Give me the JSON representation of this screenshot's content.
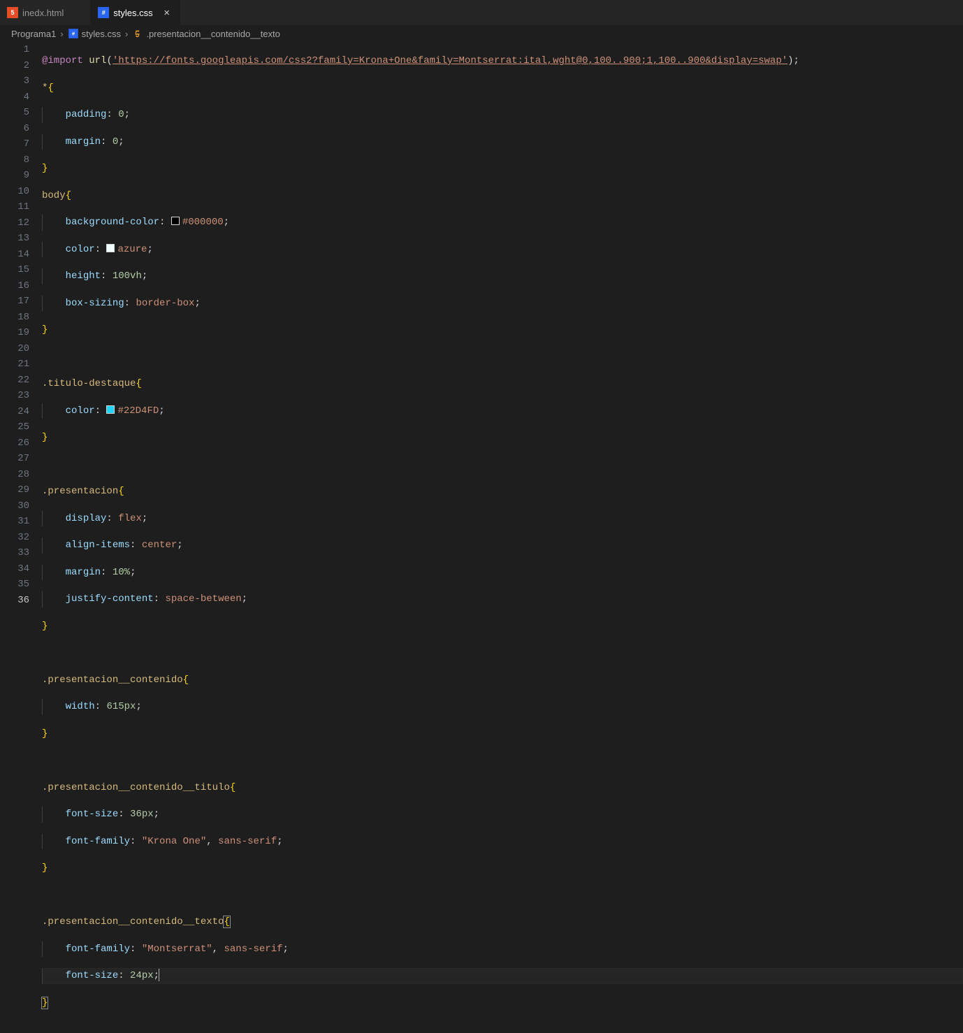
{
  "tabs": [
    {
      "label": "inedx.html",
      "icon": "html"
    },
    {
      "label": "styles.css",
      "icon": "css"
    }
  ],
  "breadcrumbs": {
    "root": "Programa1",
    "file": "styles.css",
    "symbol": ".presentacion__contenido__texto"
  },
  "code": {
    "l1": {
      "a": "@import",
      "b": "url",
      "c": "(",
      "d": "'https://fonts.googleapis.com/css2?family=Krona+One&family=Montserrat:ital,wght@0,100..900;1,100..900&display=swap'",
      "e": ")",
      "f": ";"
    },
    "l2": {
      "a": "*",
      "b": "{"
    },
    "l3": {
      "a": "padding",
      "b": ":",
      "c": "0",
      "d": ";"
    },
    "l4": {
      "a": "margin",
      "b": ":",
      "c": "0",
      "d": ";"
    },
    "l5": {
      "a": "}"
    },
    "l6": {
      "a": "body",
      "b": "{"
    },
    "l7": {
      "a": "background-color",
      "b": ":",
      "c": "#000000",
      "d": ";"
    },
    "l8": {
      "a": "color",
      "b": ":",
      "c": "azure",
      "d": ";"
    },
    "l9": {
      "a": "height",
      "b": ":",
      "c": "100vh",
      "d": ";"
    },
    "l10": {
      "a": "box-sizing",
      "b": ":",
      "c": "border-box",
      "d": ";"
    },
    "l11": {
      "a": "}"
    },
    "l13": {
      "a": ".titulo-destaque",
      "b": "{"
    },
    "l14": {
      "a": "color",
      "b": ":",
      "c": "#22D4FD",
      "d": ";"
    },
    "l15": {
      "a": "}"
    },
    "l17": {
      "a": ".presentacion",
      "b": "{"
    },
    "l18": {
      "a": "display",
      "b": ":",
      "c": "flex",
      "d": ";"
    },
    "l19": {
      "a": "align-items",
      "b": ":",
      "c": "center",
      "d": ";"
    },
    "l20": {
      "a": "margin",
      "b": ":",
      "c": "10%",
      "d": ";"
    },
    "l21": {
      "a": "justify-content",
      "b": ":",
      "c": "space-between",
      "d": ";"
    },
    "l22": {
      "a": "}"
    },
    "l24": {
      "a": ".presentacion__contenido",
      "b": "{"
    },
    "l25": {
      "a": "width",
      "b": ":",
      "c": "615px",
      "d": ";"
    },
    "l26": {
      "a": "}"
    },
    "l28": {
      "a": ".presentacion__contenido__titulo",
      "b": "{"
    },
    "l29": {
      "a": "font-size",
      "b": ":",
      "c": "36px",
      "d": ";"
    },
    "l30": {
      "a": "font-family",
      "b": ":",
      "c": "\"Krona One\"",
      "d": ",",
      "e": "sans-serif",
      "f": ";"
    },
    "l31": {
      "a": "}"
    },
    "l33": {
      "a": ".presentacion__contenido__texto",
      "b": "{"
    },
    "l34": {
      "a": "font-family",
      "b": ":",
      "c": "\"Montserrat\"",
      "d": ",",
      "e": "sans-serif",
      "f": ";"
    },
    "l35": {
      "a": "font-size",
      "b": ":",
      "c": "24px",
      "d": ";"
    },
    "l36": {
      "a": "}"
    }
  },
  "line_numbers": [
    "1",
    "2",
    "3",
    "4",
    "5",
    "6",
    "7",
    "8",
    "9",
    "10",
    "11",
    "12",
    "13",
    "14",
    "15",
    "16",
    "17",
    "18",
    "19",
    "20",
    "21",
    "22",
    "23",
    "24",
    "25",
    "26",
    "27",
    "28",
    "29",
    "30",
    "31",
    "32",
    "33",
    "34",
    "35",
    "36"
  ],
  "swatches": {
    "black": "#000000",
    "azure": "#f0ffff",
    "cyan": "#22D4FD"
  }
}
